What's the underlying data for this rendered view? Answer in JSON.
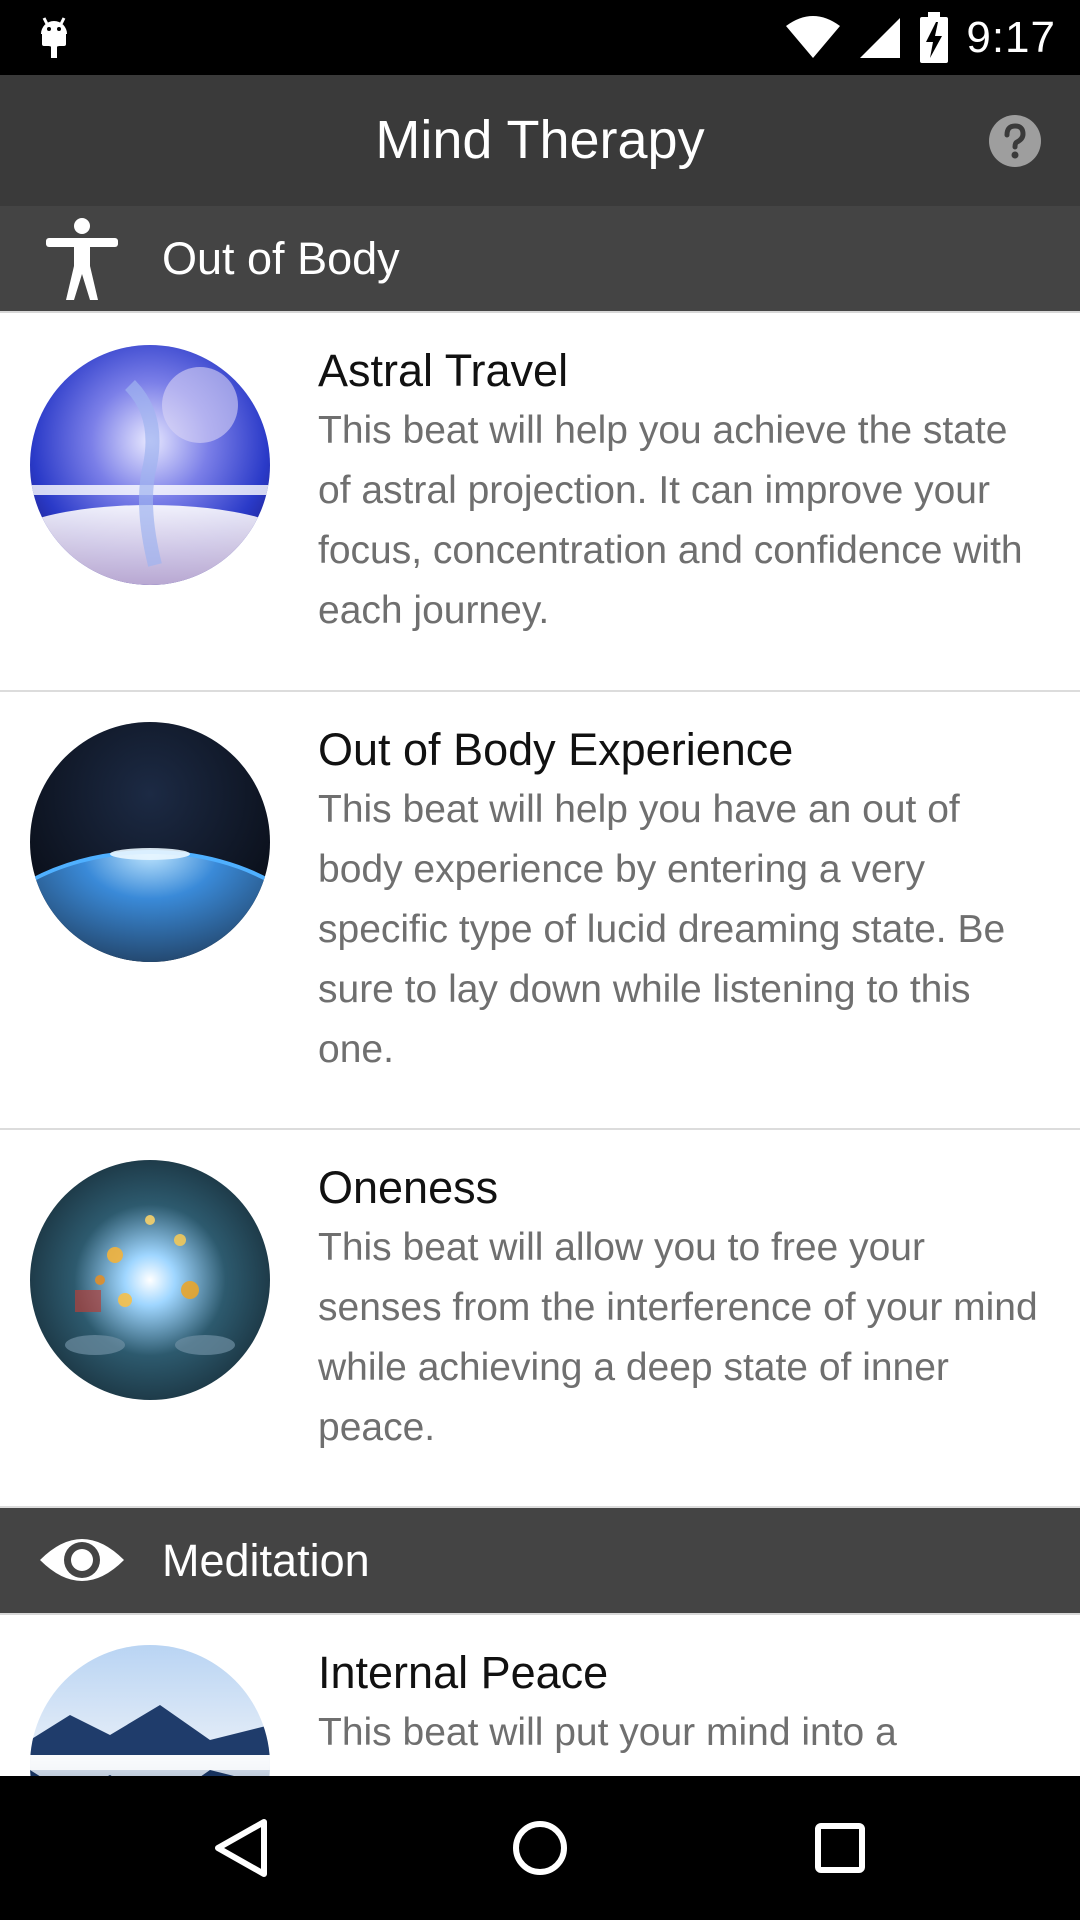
{
  "status_bar": {
    "time": "9:17",
    "icons": [
      "android-debug-icon",
      "wifi-icon",
      "signal-icon",
      "battery-charging-icon"
    ]
  },
  "app_bar": {
    "title": "Mind Therapy",
    "help_icon": "help-circle-icon"
  },
  "sections": [
    {
      "label": "Out of Body",
      "icon": "accessibility-person-icon",
      "items": [
        {
          "title": "Astral Travel",
          "description": "This beat will help you achieve the state of astral projection. It can improve your focus, concentration and confidence with each journey.",
          "image": "astral-travel-image"
        },
        {
          "title": "Out of Body Experience",
          "description": "This beat will help you have an out of body experience by entering a very specific type of lucid dreaming state. Be sure to lay down while listening to this one.",
          "image": "earth-horizon-image"
        },
        {
          "title": "Oneness",
          "description": "This beat will allow you to free your senses from the interference of your mind while achieving a deep state of inner peace.",
          "image": "cosmic-face-image"
        }
      ]
    },
    {
      "label": "Meditation",
      "icon": "eye-icon",
      "items": [
        {
          "title": "Internal Peace",
          "description": "This beat will put your mind into a",
          "image": "mountain-lake-image"
        }
      ]
    }
  ],
  "nav_bar": {
    "back": "back-triangle-icon",
    "home": "home-circle-icon",
    "recents": "recents-square-icon"
  },
  "colors": {
    "status_bar": "#000000",
    "app_bar": "#3a3a3a",
    "section_header": "#444444",
    "title_text": "#111111",
    "description_text": "#6f6f6f"
  }
}
